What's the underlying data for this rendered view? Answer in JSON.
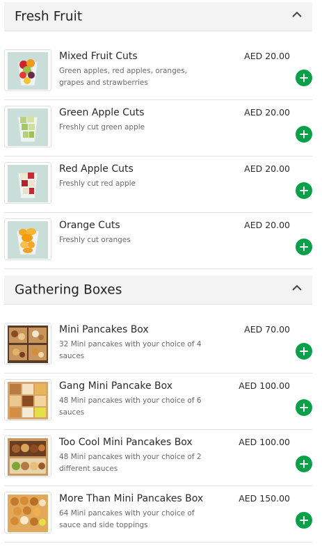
{
  "sections": [
    {
      "title": "Fresh Fruit",
      "items": [
        {
          "name": "Mixed Fruit Cuts",
          "description": "Green apples, red apples, oranges, grapes and strawberries",
          "price": "AED 20.00",
          "image_icon": "mixed-fruit-cup-icon"
        },
        {
          "name": "Green Apple Cuts",
          "description": "Freshly cut green apple",
          "price": "AED 20.00",
          "image_icon": "green-apple-cup-icon"
        },
        {
          "name": "Red Apple Cuts",
          "description": "Freshly cut red apple",
          "price": "AED 20.00",
          "image_icon": "red-apple-cup-icon"
        },
        {
          "name": "Orange Cuts",
          "description": "Freshly cut oranges",
          "price": "AED 20.00",
          "image_icon": "orange-cup-icon"
        }
      ]
    },
    {
      "title": "Gathering Boxes",
      "items": [
        {
          "name": "Mini Pancakes Box",
          "description": "32 Mini pancakes with your choice of 4 sauces",
          "price": "AED 70.00",
          "image_icon": "pancake-box-icon"
        },
        {
          "name": "Gang Mini Pancake Box",
          "description": "48 Mini pancakes with your choice of 6 sauces",
          "price": "AED 100.00",
          "image_icon": "pancake-box-icon"
        },
        {
          "name": "Too Cool Mini Pancakes Box",
          "description": "48 Mini pancakes with your choice of 2 different sauces",
          "price": "AED 100.00",
          "image_icon": "pancake-box-icon"
        },
        {
          "name": "More Than Mini Pancakes Box",
          "description": "64 Mini pancakes with your choice of sauce and side toppings",
          "price": "AED 150.00",
          "image_icon": "pancake-box-icon"
        }
      ]
    }
  ],
  "colors": {
    "add_button": "#0aa04a",
    "header_background": "#f3f3f3",
    "thumb_background_fruit": "#c9ded9",
    "thumb_background_box": "#d9a46a"
  }
}
